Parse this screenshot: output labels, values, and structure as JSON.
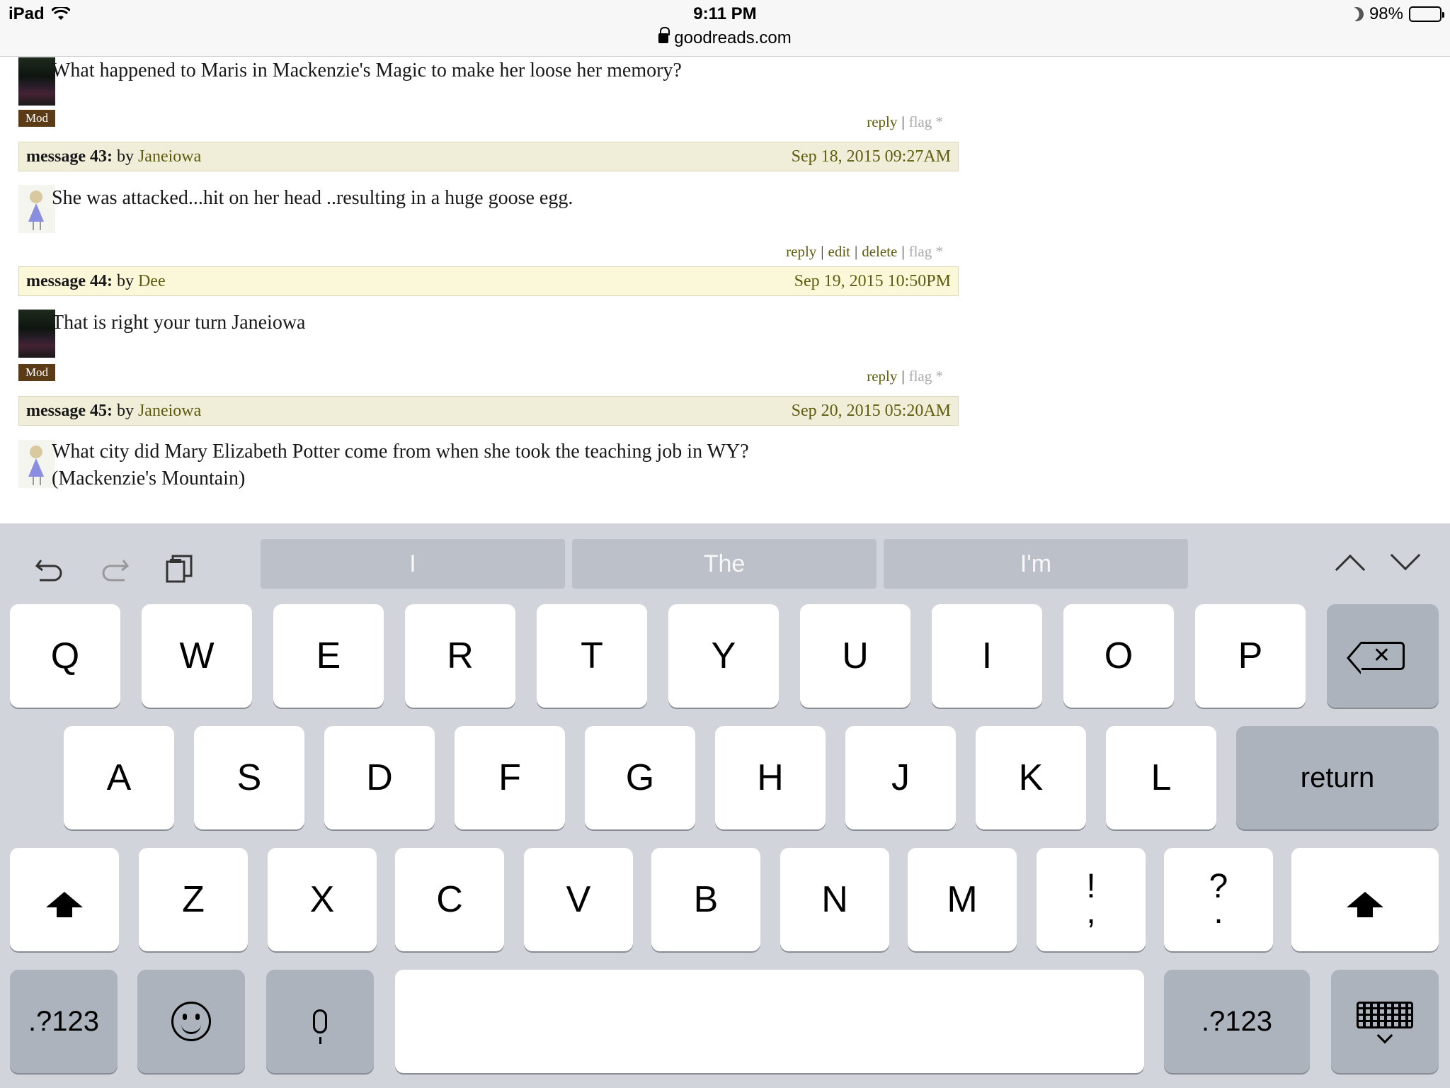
{
  "status_bar": {
    "device": "iPad",
    "time": "9:11 PM",
    "url": "goodreads.com",
    "battery": "98%"
  },
  "posts": [
    {
      "text": "What happened to Maris in Mackenzie's Magic to make her loose her memory?",
      "badge": "Mod",
      "actions": {
        "reply": "reply",
        "flag": "flag *"
      }
    },
    {
      "header_label": "message 43:",
      "by": "by",
      "author": "Janeiowa",
      "date": "Sep 18, 2015 09:27AM",
      "text": "She was attacked...hit on her head ..resulting in a huge goose egg.",
      "actions": {
        "reply": "reply",
        "edit": "edit",
        "delete": "delete",
        "flag": "flag *"
      }
    },
    {
      "header_label": "message 44:",
      "by": "by",
      "author": "Dee",
      "date": "Sep 19, 2015 10:50PM",
      "text": "That is right your turn Janeiowa",
      "badge": "Mod",
      "actions": {
        "reply": "reply",
        "flag": "flag *"
      }
    },
    {
      "header_label": "message 45:",
      "by": "by",
      "author": "Janeiowa",
      "date": "Sep 20, 2015 05:20AM",
      "text_line1": "What city did Mary Elizabeth Potter come from when she took the teaching job in WY?",
      "text_line2": "(Mackenzie's Mountain)"
    }
  ],
  "keyboard": {
    "suggestions": [
      "I",
      "The",
      "I'm"
    ],
    "row1": [
      "Q",
      "W",
      "E",
      "R",
      "T",
      "Y",
      "U",
      "I",
      "O",
      "P"
    ],
    "row2": [
      "A",
      "S",
      "D",
      "F",
      "G",
      "H",
      "J",
      "K",
      "L"
    ],
    "row3": [
      "Z",
      "X",
      "C",
      "V",
      "B",
      "N",
      "M"
    ],
    "punct1": {
      "top": "!",
      "bottom": ","
    },
    "punct2": {
      "top": "?",
      "bottom": "."
    },
    "return_label": "return",
    "numbers_label": ".?123",
    "icons": {
      "undo": "undo-icon",
      "redo": "redo-icon",
      "paste": "paste-icon",
      "prev": "chevron-up-icon",
      "next": "chevron-down-icon",
      "backspace": "backspace-icon",
      "shift": "shift-icon",
      "emoji": "emoji-icon",
      "mic": "microphone-icon",
      "hide": "keyboard-hide-icon"
    }
  }
}
